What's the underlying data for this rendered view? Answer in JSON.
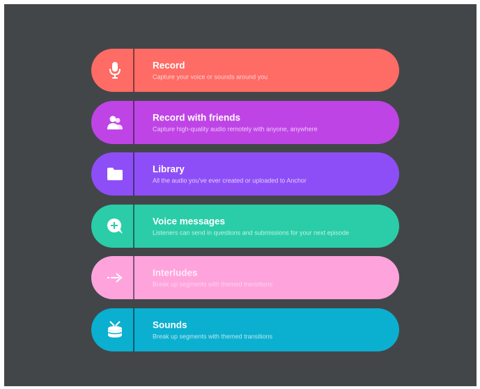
{
  "menu": {
    "items": [
      {
        "title": "Record",
        "subtitle": "Capture your voice or sounds around you",
        "icon": "microphone-icon",
        "color": "#FF6B65"
      },
      {
        "title": "Record with friends",
        "subtitle": "Capture high-quality audio remotely with anyone, anywhere",
        "icon": "friends-icon",
        "color": "#BF44E6"
      },
      {
        "title": "Library",
        "subtitle": "All the audio you've ever created or uploaded to Anchor",
        "icon": "folder-icon",
        "color": "#8E4EF7"
      },
      {
        "title": "Voice messages",
        "subtitle": "Listeners can send in questions and submissions for your next episode",
        "icon": "voice-message-icon",
        "color": "#2ACDA8"
      },
      {
        "title": "Interludes",
        "subtitle": "Break up segments with themed transitions",
        "icon": "arrow-right-icon",
        "color": "#FFA3DD"
      },
      {
        "title": "Sounds",
        "subtitle": "Break up segments with themed transitions",
        "icon": "drum-icon",
        "color": "#0BAFD0"
      }
    ]
  }
}
